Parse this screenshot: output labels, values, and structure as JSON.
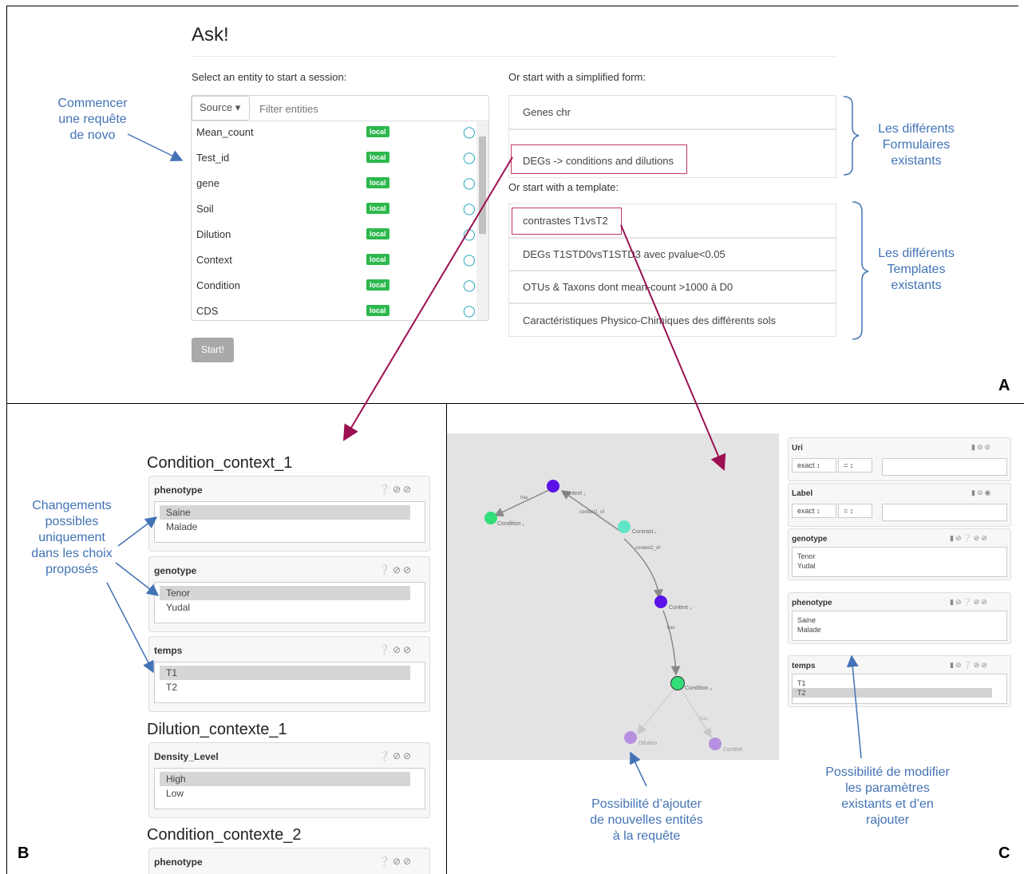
{
  "panel_a": {
    "title": "Ask!",
    "entity_prompt": "Select an entity to start a session:",
    "source_button": "Source ▾",
    "filter_placeholder": "Filter entities",
    "entities": [
      {
        "name": "Mean_count",
        "badge": "local"
      },
      {
        "name": "Test_id",
        "badge": "local"
      },
      {
        "name": "gene",
        "badge": "local"
      },
      {
        "name": "Soil",
        "badge": "local"
      },
      {
        "name": "Dilution",
        "badge": "local"
      },
      {
        "name": "Context",
        "badge": "local"
      },
      {
        "name": "Condition",
        "badge": "local"
      },
      {
        "name": "CDS",
        "badge": "local"
      }
    ],
    "start_button": "Start!",
    "simplified_prompt": "Or start with a simplified form:",
    "forms": [
      "Genes chr",
      "DEGs -> conditions and dilutions"
    ],
    "template_prompt": "Or start with a template:",
    "templates": [
      "contrastes T1vsT2",
      "DEGs T1STD0vsT1STD3 avec pvalue<0.05",
      "OTUs & Taxons dont mean-count >1000 à D0",
      "Caractéristiques Physico-Chimiques des différents sols"
    ],
    "annot_start": [
      "Commencer",
      "une requête",
      "de novo"
    ],
    "annot_forms": [
      "Les différents",
      "Formulaires",
      "existants"
    ],
    "annot_templates": [
      "Les différents",
      "Templates",
      "existants"
    ],
    "letter": "A"
  },
  "panel_b": {
    "sections": [
      {
        "title": "Condition_context_1"
      },
      {
        "title": "Dilution_contexte_1"
      },
      {
        "title": "Condition_contexte_2"
      }
    ],
    "cards": [
      {
        "label": "phenotype",
        "options": [
          "Saine",
          "Malade"
        ]
      },
      {
        "label": "genotype",
        "options": [
          "Tenor",
          "Yudal"
        ]
      },
      {
        "label": "temps",
        "options": [
          "T1",
          "T2"
        ]
      },
      {
        "label": "Density_Level",
        "options": [
          "High",
          "Low"
        ]
      },
      {
        "label": "phenotype",
        "options": []
      }
    ],
    "annot": [
      "Changements",
      "possibles",
      "uniquement",
      "dans les choix",
      "proposés"
    ],
    "letter": "B"
  },
  "panel_c": {
    "nodes": [
      "Context ₁",
      "Condition ₁",
      "Contrast ₁",
      "Context ₂",
      "Condition ₂",
      "Dilution",
      "Context"
    ],
    "edges": [
      "has",
      "context1_of",
      "context2_of",
      "has",
      "has"
    ],
    "right_cards": [
      {
        "label": "Uri",
        "sel1": "exact",
        "sel2": "="
      },
      {
        "label": "Label",
        "sel1": "exact",
        "sel2": "="
      },
      {
        "label": "genotype",
        "options": [
          "Tenor",
          "Yudal"
        ]
      },
      {
        "label": "phenotype",
        "options": [
          "Saine",
          "Malade"
        ]
      },
      {
        "label": "temps",
        "options": [
          "T1",
          "T2"
        ]
      }
    ],
    "annot_graph": [
      "Possibilité d’ajouter",
      "de nouvelles entités",
      "à la requête"
    ],
    "annot_params": [
      "Possibilité de modifier",
      "les paramètres",
      "existants et d’en",
      "rajouter"
    ],
    "letter": "C"
  },
  "colors": {
    "annotation": "#4273b5",
    "arrow": "#9c1152",
    "badge": "#2db84d",
    "node_blue": "#5a12e8",
    "node_green": "#33dd77",
    "node_teal": "#5fe6c8",
    "node_lilac": "#b78fe0"
  }
}
